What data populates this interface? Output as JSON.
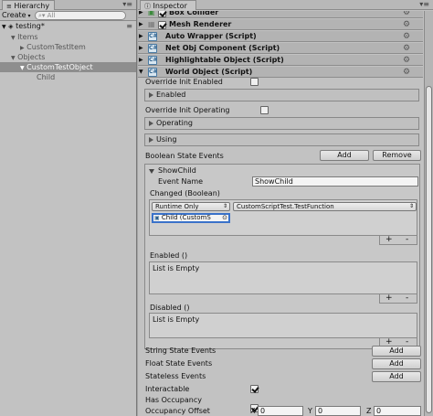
{
  "hierarchy": {
    "tab_label": "Hierarchy",
    "create_label": "Create",
    "search_placeholder": "All",
    "scene_name": "testing*",
    "tree": [
      {
        "label": "Items",
        "depth": 1
      },
      {
        "label": "CustomTestItem",
        "depth": 2
      },
      {
        "label": "Objects",
        "depth": 1
      },
      {
        "label": "CustomTestObject",
        "depth": 2,
        "selected": true
      },
      {
        "label": "Child",
        "depth": 3
      }
    ]
  },
  "inspector": {
    "tab_label": "Inspector",
    "components": [
      {
        "name": "Box Collider"
      },
      {
        "name": "Mesh Renderer"
      },
      {
        "name": "Auto Wrapper (Script)"
      },
      {
        "name": "Net Obj Component (Script)"
      },
      {
        "name": "Highlightable Object (Script)"
      },
      {
        "name": "World Object (Script)"
      }
    ],
    "override_init_enabled": "Override Init Enabled",
    "enabled_fold": "Enabled",
    "override_init_operating": "Override Init Operating",
    "operating_fold": "Operating",
    "using_fold": "Using",
    "boolean_state_events": "Boolean State Events",
    "add_label": "Add",
    "remove_label": "Remove",
    "showchild_header": "ShowChild",
    "event_name_label": "Event Name",
    "event_name_value": "ShowChild",
    "changed_label": "Changed (Boolean)",
    "runtime_option": "Runtime Only",
    "function_option": "CustomScriptTest.TestFunction",
    "object_ref": "Child (CustomS",
    "enabled_event": "Enabled ()",
    "disabled_event": "Disabled ()",
    "list_empty": "List is Empty",
    "plus": "+",
    "minus": "-",
    "string_state_events": "String State Events",
    "float_state_events": "Float State Events",
    "stateless_events": "Stateless Events",
    "interactable": "Interactable",
    "has_occupancy": "Has Occupancy",
    "occupancy_offset": "Occupancy Offset",
    "axis_x": "X",
    "axis_y": "Y",
    "axis_z": "Z",
    "offset_x": "0",
    "offset_y": "0",
    "offset_z": "0"
  },
  "colors": {
    "selection": "#8e8e8e",
    "panel": "#a3a3a3",
    "inspector_bg": "#c2c2c2",
    "script_icon": "#4a7aa3"
  }
}
